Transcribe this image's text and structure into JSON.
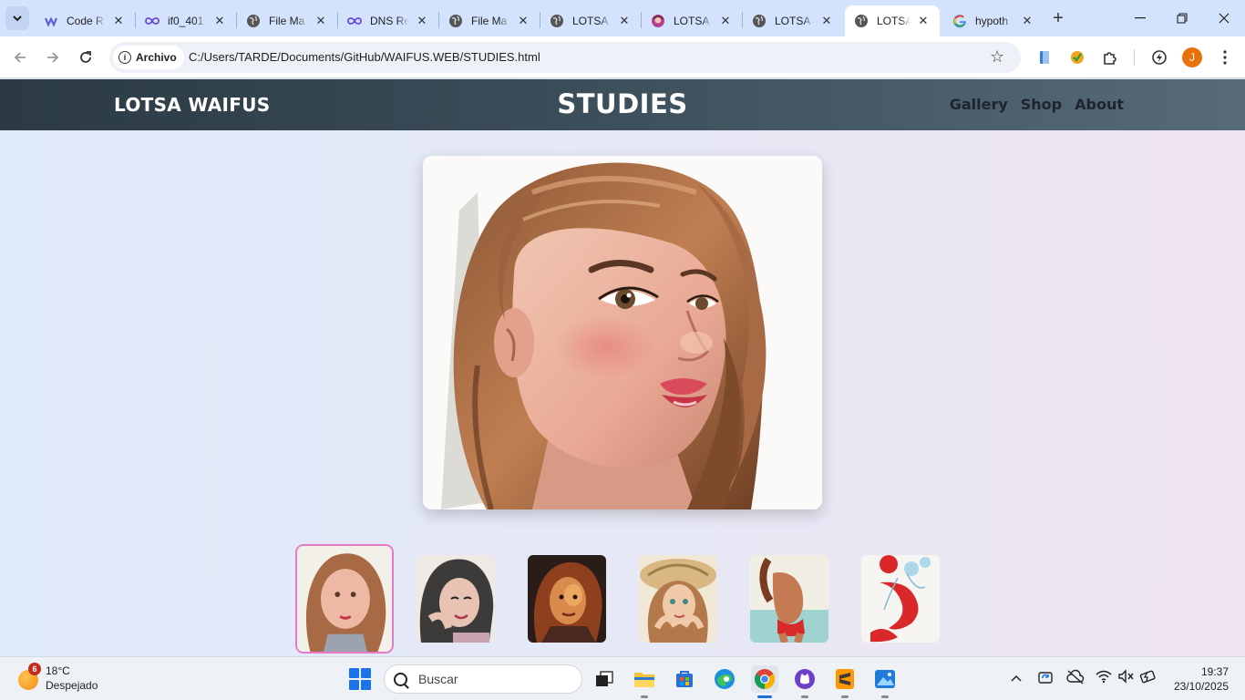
{
  "browser": {
    "tabs": [
      {
        "title": "Code R",
        "icon": "codeium-icon",
        "active": false
      },
      {
        "title": "if0_401",
        "icon": "infinity-icon",
        "active": false
      },
      {
        "title": "File Ma",
        "icon": "globe-icon",
        "active": false
      },
      {
        "title": "DNS Re",
        "icon": "infinity-icon",
        "active": false
      },
      {
        "title": "File Ma",
        "icon": "globe-icon",
        "active": false
      },
      {
        "title": "LOTSA",
        "icon": "globe-icon",
        "active": false
      },
      {
        "title": "LOTSA",
        "icon": "avatar-favicon-icon",
        "active": false
      },
      {
        "title": "LOTSA-",
        "icon": "globe-icon",
        "active": false
      },
      {
        "title": "LOTSA-",
        "icon": "globe-icon",
        "active": true
      },
      {
        "title": "hypoth",
        "icon": "google-icon",
        "active": false
      }
    ],
    "address_chip": "Archivo",
    "url": "C:/Users/TARDE/Documents/GitHub/WAIFUS.WEB/STUDIES.html",
    "profile_initial": "J"
  },
  "site": {
    "brand": "LOTSA WAIFUS",
    "title": "STUDIES",
    "nav": [
      "Gallery",
      "Shop",
      "About"
    ]
  },
  "gallery": {
    "selected_index": 0,
    "thumbnail_count": 6,
    "accent_color": "#e879c8"
  },
  "taskbar": {
    "weather_badge": "6",
    "temperature": "18°C",
    "condition": "Despejado",
    "search_placeholder": "Buscar",
    "time": "19:37",
    "date": "23/10/2025"
  }
}
